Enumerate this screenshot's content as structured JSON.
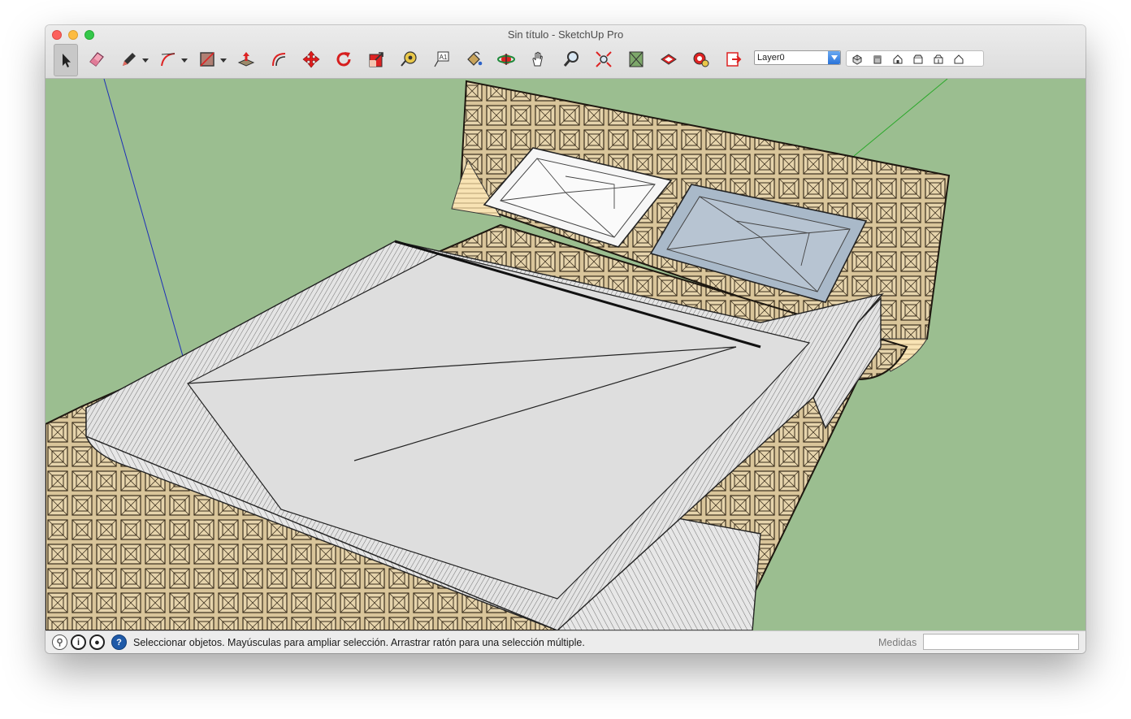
{
  "window": {
    "title": "Sin título - SketchUp Pro"
  },
  "toolbar": {
    "tools": [
      {
        "id": "select",
        "icon": "arrow-select-icon",
        "active": true
      },
      {
        "id": "eraser",
        "icon": "eraser-icon"
      },
      {
        "id": "line",
        "icon": "pencil-icon",
        "dropdown": true
      },
      {
        "id": "arc",
        "icon": "arc-icon",
        "dropdown": true
      },
      {
        "id": "rectangle",
        "icon": "rectangle-icon",
        "dropdown": true
      },
      {
        "id": "push-pull",
        "icon": "push-pull-icon"
      },
      {
        "id": "offset",
        "icon": "offset-icon"
      },
      {
        "id": "move",
        "icon": "move-icon"
      },
      {
        "id": "rotate",
        "icon": "rotate-icon"
      },
      {
        "id": "scale",
        "icon": "scale-icon"
      },
      {
        "id": "tape-measure",
        "icon": "tape-measure-icon"
      },
      {
        "id": "text",
        "icon": "text-icon"
      },
      {
        "id": "paint-bucket",
        "icon": "paint-bucket-icon"
      },
      {
        "id": "orbit",
        "icon": "orbit-icon"
      },
      {
        "id": "pan",
        "icon": "hand-pan-icon"
      },
      {
        "id": "zoom",
        "icon": "magnifier-icon"
      },
      {
        "id": "zoom-extents",
        "icon": "zoom-extents-icon"
      },
      {
        "id": "3d-warehouse",
        "icon": "warehouse-icon"
      },
      {
        "id": "extension-warehouse",
        "icon": "extension-warehouse-icon"
      },
      {
        "id": "extension-manager",
        "icon": "extension-manager-icon"
      },
      {
        "id": "send-to-layout",
        "icon": "send-to-layout-icon"
      }
    ],
    "layer": {
      "selected": "Layer0"
    },
    "views": [
      "iso-view-icon",
      "top-view-icon",
      "front-view-icon",
      "right-view-icon",
      "back-view-icon",
      "left-view-icon"
    ]
  },
  "statusbar": {
    "message": "Seleccionar objetos. Mayúsculas para ampliar selección. Arrastrar ratón para una selección múltiple.",
    "measurements_label": "Medidas",
    "measurements_value": ""
  },
  "colors": {
    "sky": "#9bbe90",
    "wood": "#e8d4a8",
    "sheet": "#dedede",
    "pillar_blue": "#a9b9c9"
  }
}
